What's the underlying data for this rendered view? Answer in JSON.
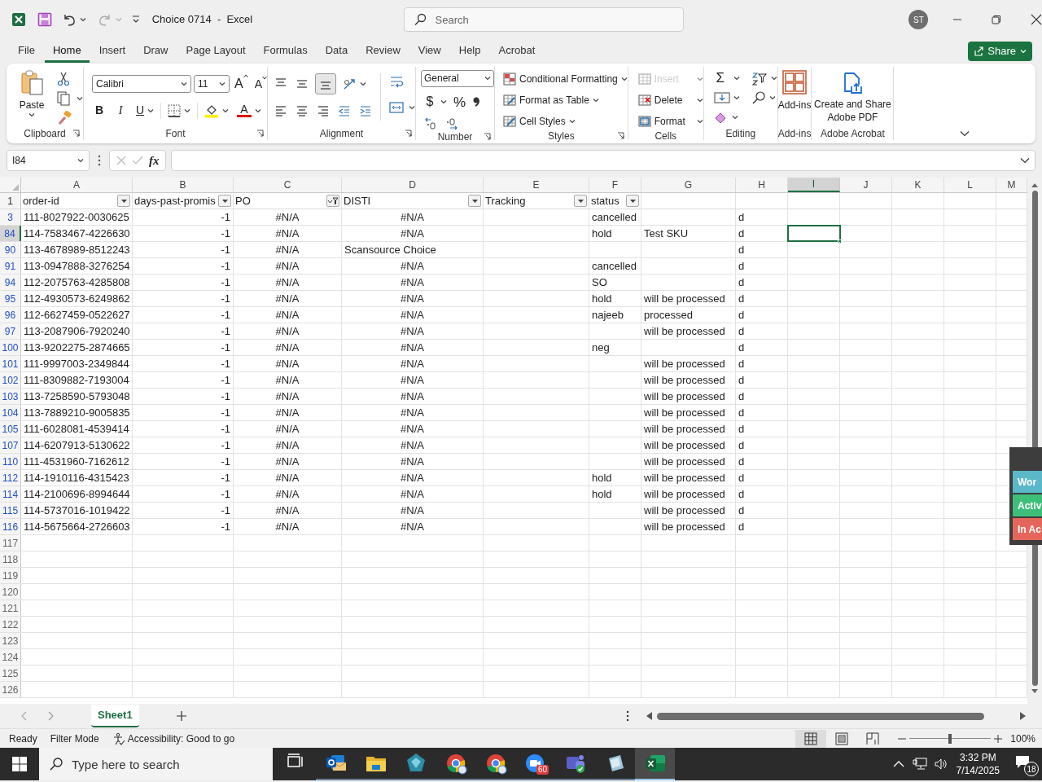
{
  "title_bar": {
    "title": "Choice 0714  -  Excel",
    "search_placeholder": "Search",
    "avatar": "ST"
  },
  "menu_tabs": [
    {
      "label": "File",
      "selected": false
    },
    {
      "label": "Home",
      "selected": true
    },
    {
      "label": "Insert",
      "selected": false
    },
    {
      "label": "Draw",
      "selected": false
    },
    {
      "label": "Page Layout",
      "selected": false
    },
    {
      "label": "Formulas",
      "selected": false
    },
    {
      "label": "Data",
      "selected": false
    },
    {
      "label": "Review",
      "selected": false
    },
    {
      "label": "View",
      "selected": false
    },
    {
      "label": "Help",
      "selected": false
    },
    {
      "label": "Acrobat",
      "selected": false
    }
  ],
  "share_button": "Share",
  "ribbon": {
    "clipboard": {
      "paste": "Paste",
      "group": "Clipboard"
    },
    "font": {
      "font_name": "Calibri",
      "font_size": "11",
      "grow": "A",
      "shrink": "A",
      "bold": "B",
      "italic": "I",
      "underline": "U",
      "font_color": "A",
      "group": "Font"
    },
    "alignment": {
      "group": "Alignment"
    },
    "number": {
      "format": "General",
      "currency": "$",
      "percent": "%",
      "group": "Number"
    },
    "styles": {
      "items": [
        "Conditional Formatting",
        "Format as Table",
        "Cell Styles"
      ],
      "group": "Styles"
    },
    "cells": {
      "items": [
        {
          "label": "Insert",
          "disabled": true
        },
        {
          "label": "Delete",
          "disabled": false
        },
        {
          "label": "Format",
          "disabled": false
        }
      ],
      "group": "Cells"
    },
    "editing": {
      "autosum": "Σ",
      "group": "Editing"
    },
    "add_ins": {
      "button": "Add-ins",
      "group": "Add-ins"
    },
    "acrobat": {
      "button": "Create and Share Adobe PDF",
      "group": "Adobe Acrobat"
    }
  },
  "formula_bar": {
    "name_box": "I84",
    "function_label": "fx"
  },
  "columns": [
    {
      "letter": "A",
      "selected": false
    },
    {
      "letter": "B",
      "selected": false
    },
    {
      "letter": "C",
      "selected": false
    },
    {
      "letter": "D",
      "selected": false
    },
    {
      "letter": "E",
      "selected": false
    },
    {
      "letter": "F",
      "selected": false
    },
    {
      "letter": "G",
      "selected": false
    },
    {
      "letter": "H",
      "selected": false
    },
    {
      "letter": "I",
      "selected": true
    },
    {
      "letter": "J",
      "selected": false
    },
    {
      "letter": "K",
      "selected": false
    },
    {
      "letter": "L",
      "selected": false
    },
    {
      "letter": "M",
      "selected": false
    }
  ],
  "header_row": {
    "number": "1",
    "cells": [
      {
        "text": "order-id",
        "filtered": false
      },
      {
        "text": "days-past-promis",
        "filtered": false
      },
      {
        "text": "PO",
        "filtered": true
      },
      {
        "text": "DISTI",
        "filtered": false
      },
      {
        "text": "Tracking",
        "filtered": false
      },
      {
        "text": "status",
        "filtered": false
      }
    ]
  },
  "rows": [
    {
      "number": "3",
      "selected": false,
      "filtered": true,
      "cells": {
        "A": {
          "text": "111-8027922-0030625",
          "kind": "text"
        },
        "B": {
          "text": "-1",
          "kind": "number"
        },
        "C": {
          "text": "#N/A",
          "kind": "error"
        },
        "D": {
          "text": "#N/A",
          "kind": "error"
        },
        "F": {
          "text": "cancelled",
          "kind": "text"
        },
        "H": {
          "text": "d",
          "kind": "text"
        }
      }
    },
    {
      "number": "84",
      "selected": true,
      "filtered": true,
      "cells": {
        "A": {
          "text": "114-7583467-4226630",
          "kind": "text"
        },
        "B": {
          "text": "-1",
          "kind": "number"
        },
        "C": {
          "text": "#N/A",
          "kind": "error"
        },
        "D": {
          "text": "#N/A",
          "kind": "error"
        },
        "F": {
          "text": "hold",
          "kind": "text"
        },
        "G": {
          "text": "Test SKU",
          "kind": "text"
        },
        "H": {
          "text": "d",
          "kind": "text"
        }
      }
    },
    {
      "number": "90",
      "selected": false,
      "filtered": true,
      "cells": {
        "A": {
          "text": "113-4678989-8512243",
          "kind": "text"
        },
        "B": {
          "text": "-1",
          "kind": "number"
        },
        "C": {
          "text": "#N/A",
          "kind": "error"
        },
        "D": {
          "text": "Scansource Choice",
          "kind": "text"
        },
        "H": {
          "text": "d",
          "kind": "text"
        }
      }
    },
    {
      "number": "91",
      "selected": false,
      "filtered": true,
      "cells": {
        "A": {
          "text": "113-0947888-3276254",
          "kind": "text"
        },
        "B": {
          "text": "-1",
          "kind": "number"
        },
        "C": {
          "text": "#N/A",
          "kind": "error"
        },
        "D": {
          "text": "#N/A",
          "kind": "error"
        },
        "F": {
          "text": "cancelled",
          "kind": "text"
        },
        "H": {
          "text": "d",
          "kind": "text"
        }
      }
    },
    {
      "number": "94",
      "selected": false,
      "filtered": true,
      "cells": {
        "A": {
          "text": "112-2075763-4285808",
          "kind": "text"
        },
        "B": {
          "text": "-1",
          "kind": "number"
        },
        "C": {
          "text": "#N/A",
          "kind": "error"
        },
        "D": {
          "text": "#N/A",
          "kind": "error"
        },
        "F": {
          "text": "SO",
          "kind": "text"
        },
        "H": {
          "text": "d",
          "kind": "text"
        }
      }
    },
    {
      "number": "95",
      "selected": false,
      "filtered": true,
      "cells": {
        "A": {
          "text": "112-4930573-6249862",
          "kind": "text"
        },
        "B": {
          "text": "-1",
          "kind": "number"
        },
        "C": {
          "text": "#N/A",
          "kind": "error"
        },
        "D": {
          "text": "#N/A",
          "kind": "error"
        },
        "F": {
          "text": "hold",
          "kind": "text"
        },
        "G": {
          "text": "will be processed",
          "kind": "text"
        },
        "H": {
          "text": "d",
          "kind": "text"
        }
      }
    },
    {
      "number": "96",
      "selected": false,
      "filtered": true,
      "cells": {
        "A": {
          "text": "112-6627459-0522627",
          "kind": "text"
        },
        "B": {
          "text": "-1",
          "kind": "number"
        },
        "C": {
          "text": "#N/A",
          "kind": "error"
        },
        "D": {
          "text": "#N/A",
          "kind": "error"
        },
        "F": {
          "text": "najeeb",
          "kind": "text"
        },
        "G": {
          "text": "processed",
          "kind": "text"
        },
        "H": {
          "text": "d",
          "kind": "text"
        }
      }
    },
    {
      "number": "97",
      "selected": false,
      "filtered": true,
      "cells": {
        "A": {
          "text": "113-2087906-7920240",
          "kind": "text"
        },
        "B": {
          "text": "-1",
          "kind": "number"
        },
        "C": {
          "text": "#N/A",
          "kind": "error"
        },
        "D": {
          "text": "#N/A",
          "kind": "error"
        },
        "G": {
          "text": "will be processed",
          "kind": "text"
        },
        "H": {
          "text": "d",
          "kind": "text"
        }
      }
    },
    {
      "number": "100",
      "selected": false,
      "filtered": true,
      "cells": {
        "A": {
          "text": "113-9202275-2874665",
          "kind": "text"
        },
        "B": {
          "text": "-1",
          "kind": "number"
        },
        "C": {
          "text": "#N/A",
          "kind": "error"
        },
        "D": {
          "text": "#N/A",
          "kind": "error"
        },
        "F": {
          "text": "neg",
          "kind": "text"
        },
        "H": {
          "text": "d",
          "kind": "text"
        }
      }
    },
    {
      "number": "101",
      "selected": false,
      "filtered": true,
      "cells": {
        "A": {
          "text": "111-9997003-2349844",
          "kind": "text"
        },
        "B": {
          "text": "-1",
          "kind": "number"
        },
        "C": {
          "text": "#N/A",
          "kind": "error"
        },
        "D": {
          "text": "#N/A",
          "kind": "error"
        },
        "G": {
          "text": "will be processed",
          "kind": "text"
        },
        "H": {
          "text": "d",
          "kind": "text"
        }
      }
    },
    {
      "number": "102",
      "selected": false,
      "filtered": true,
      "cells": {
        "A": {
          "text": "111-8309882-7193004",
          "kind": "text"
        },
        "B": {
          "text": "-1",
          "kind": "number"
        },
        "C": {
          "text": "#N/A",
          "kind": "error"
        },
        "D": {
          "text": "#N/A",
          "kind": "error"
        },
        "G": {
          "text": "will be processed",
          "kind": "text"
        },
        "H": {
          "text": "d",
          "kind": "text"
        }
      }
    },
    {
      "number": "103",
      "selected": false,
      "filtered": true,
      "cells": {
        "A": {
          "text": "113-7258590-5793048",
          "kind": "text"
        },
        "B": {
          "text": "-1",
          "kind": "number"
        },
        "C": {
          "text": "#N/A",
          "kind": "error"
        },
        "D": {
          "text": "#N/A",
          "kind": "error"
        },
        "G": {
          "text": "will be processed",
          "kind": "text"
        },
        "H": {
          "text": "d",
          "kind": "text"
        }
      }
    },
    {
      "number": "104",
      "selected": false,
      "filtered": true,
      "cells": {
        "A": {
          "text": "113-7889210-9005835",
          "kind": "text"
        },
        "B": {
          "text": "-1",
          "kind": "number"
        },
        "C": {
          "text": "#N/A",
          "kind": "error"
        },
        "D": {
          "text": "#N/A",
          "kind": "error"
        },
        "G": {
          "text": "will be processed",
          "kind": "text"
        },
        "H": {
          "text": "d",
          "kind": "text"
        }
      }
    },
    {
      "number": "105",
      "selected": false,
      "filtered": true,
      "cells": {
        "A": {
          "text": "111-6028081-4539414",
          "kind": "text"
        },
        "B": {
          "text": "-1",
          "kind": "number"
        },
        "C": {
          "text": "#N/A",
          "kind": "error"
        },
        "D": {
          "text": "#N/A",
          "kind": "error"
        },
        "G": {
          "text": "will be processed",
          "kind": "text"
        },
        "H": {
          "text": "d",
          "kind": "text"
        }
      }
    },
    {
      "number": "107",
      "selected": false,
      "filtered": true,
      "cells": {
        "A": {
          "text": "114-6207913-5130622",
          "kind": "text"
        },
        "B": {
          "text": "-1",
          "kind": "number"
        },
        "C": {
          "text": "#N/A",
          "kind": "error"
        },
        "D": {
          "text": "#N/A",
          "kind": "error"
        },
        "G": {
          "text": "will be processed",
          "kind": "text"
        },
        "H": {
          "text": "d",
          "kind": "text"
        }
      }
    },
    {
      "number": "110",
      "selected": false,
      "filtered": true,
      "cells": {
        "A": {
          "text": "111-4531960-7162612",
          "kind": "text"
        },
        "B": {
          "text": "-1",
          "kind": "number"
        },
        "C": {
          "text": "#N/A",
          "kind": "error"
        },
        "D": {
          "text": "#N/A",
          "kind": "error"
        },
        "G": {
          "text": "will be processed",
          "kind": "text"
        },
        "H": {
          "text": "d",
          "kind": "text"
        }
      }
    },
    {
      "number": "112",
      "selected": false,
      "filtered": true,
      "cells": {
        "A": {
          "text": "114-1910116-4315423",
          "kind": "text"
        },
        "B": {
          "text": "-1",
          "kind": "number"
        },
        "C": {
          "text": "#N/A",
          "kind": "error"
        },
        "D": {
          "text": "#N/A",
          "kind": "error"
        },
        "F": {
          "text": "hold",
          "kind": "text"
        },
        "G": {
          "text": "will be processed",
          "kind": "text"
        },
        "H": {
          "text": "d",
          "kind": "text"
        }
      }
    },
    {
      "number": "114",
      "selected": false,
      "filtered": true,
      "cells": {
        "A": {
          "text": "114-2100696-8994644",
          "kind": "text"
        },
        "B": {
          "text": "-1",
          "kind": "number"
        },
        "C": {
          "text": "#N/A",
          "kind": "error"
        },
        "D": {
          "text": "#N/A",
          "kind": "error"
        },
        "F": {
          "text": "hold",
          "kind": "text"
        },
        "G": {
          "text": "will be processed",
          "kind": "text"
        },
        "H": {
          "text": "d",
          "kind": "text"
        }
      }
    },
    {
      "number": "115",
      "selected": false,
      "filtered": true,
      "cells": {
        "A": {
          "text": "114-5737016-1019422",
          "kind": "text"
        },
        "B": {
          "text": "-1",
          "kind": "number"
        },
        "C": {
          "text": "#N/A",
          "kind": "error"
        },
        "D": {
          "text": "#N/A",
          "kind": "error"
        },
        "G": {
          "text": "will be processed",
          "kind": "text"
        },
        "H": {
          "text": "d",
          "kind": "text"
        }
      }
    },
    {
      "number": "116",
      "selected": false,
      "filtered": true,
      "cells": {
        "A": {
          "text": "114-5675664-2726603",
          "kind": "text"
        },
        "B": {
          "text": "-1",
          "kind": "number"
        },
        "C": {
          "text": "#N/A",
          "kind": "error"
        },
        "D": {
          "text": "#N/A",
          "kind": "error"
        },
        "G": {
          "text": "will be processed",
          "kind": "text"
        },
        "H": {
          "text": "d",
          "kind": "text"
        }
      }
    },
    {
      "number": "117",
      "selected": false,
      "filtered": false
    },
    {
      "number": "118",
      "selected": false,
      "filtered": false
    },
    {
      "number": "119",
      "selected": false,
      "filtered": false
    },
    {
      "number": "120",
      "selected": false,
      "filtered": false
    },
    {
      "number": "121",
      "selected": false,
      "filtered": false
    },
    {
      "number": "122",
      "selected": false,
      "filtered": false
    },
    {
      "number": "123",
      "selected": false,
      "filtered": false
    },
    {
      "number": "124",
      "selected": false,
      "filtered": false
    },
    {
      "number": "125",
      "selected": false,
      "filtered": false
    },
    {
      "number": "126",
      "selected": false,
      "filtered": false
    }
  ],
  "side_panel": [
    {
      "label": "Wor",
      "color": "#5bb8c9"
    },
    {
      "label": "Activ",
      "color": "#3dbf7a"
    },
    {
      "label": "In Ac",
      "color": "#e5665a"
    }
  ],
  "sheet_tabs": [
    {
      "label": "Sheet1",
      "selected": true
    }
  ],
  "status_bar": {
    "items": [
      "Ready",
      "Filter Mode"
    ],
    "accessibility": "Accessibility: Good to go",
    "views": [
      {
        "kind": "normal",
        "selected": true
      },
      {
        "kind": "page_layout",
        "selected": false
      },
      {
        "kind": "page_break",
        "selected": false
      }
    ],
    "zoom": "100%",
    "zoom_slider": {
      "level": 0.5
    }
  },
  "taskbar": {
    "search_placeholder": "Type here to search",
    "apps": [
      {
        "kind": "task_view",
        "active": false
      },
      {
        "kind": "outlook",
        "active": false
      },
      {
        "kind": "folder",
        "active": false
      },
      {
        "kind": "diamond",
        "active": false
      },
      {
        "kind": "chrome",
        "active": false
      },
      {
        "kind": "chrome",
        "active": false
      },
      {
        "kind": "zoom",
        "active": false,
        "badge": "60"
      },
      {
        "kind": "teams",
        "active": false
      },
      {
        "kind": "crystal",
        "active": false
      },
      {
        "kind": "excel",
        "active": true
      }
    ],
    "time": "3:32 PM",
    "date": "7/14/2025",
    "notifications": "18"
  }
}
